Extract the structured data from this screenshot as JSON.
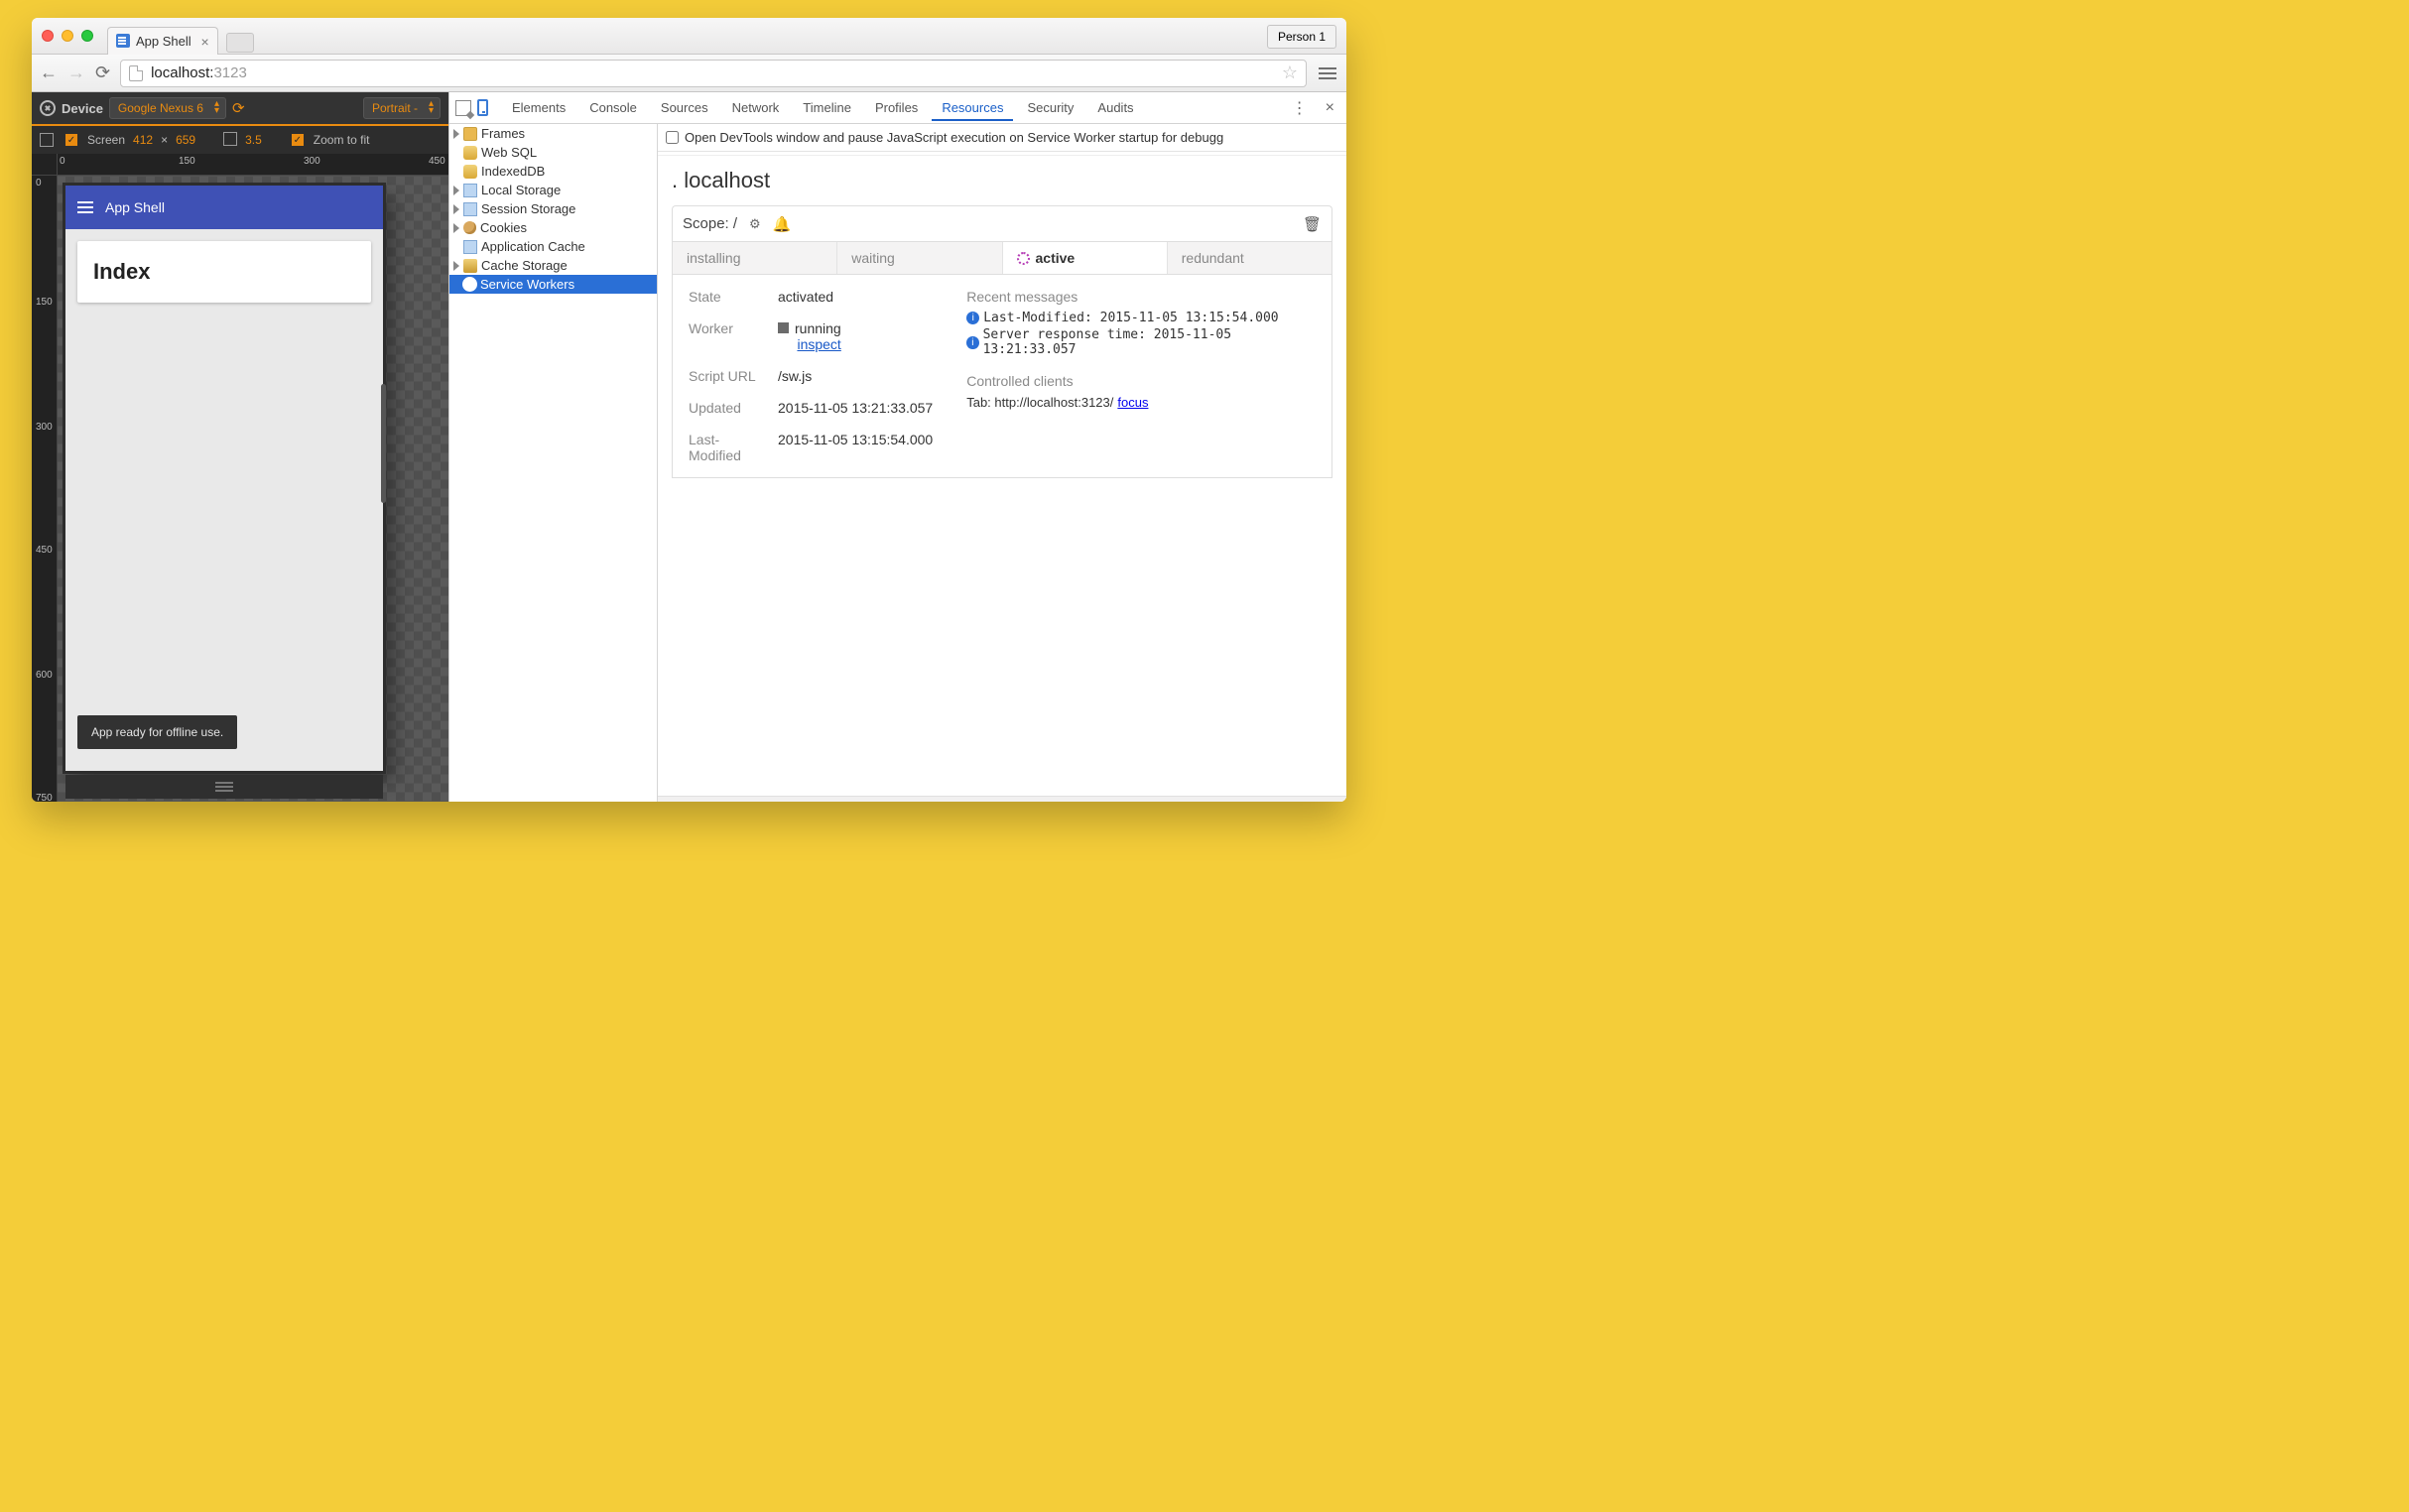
{
  "browser": {
    "tab_title": "App Shell",
    "person": "Person 1",
    "url_host": "localhost:",
    "url_port": "3123"
  },
  "device_mode": {
    "label": "Device",
    "device": "Google Nexus 6",
    "orientation": "Portrait -",
    "screen_label": "Screen",
    "width": "412",
    "height": "659",
    "dpr": "3.5",
    "zoom": "Zoom to fit",
    "ruler_h": [
      "0",
      "150",
      "300",
      "450"
    ],
    "ruler_v": [
      "0",
      "150",
      "300",
      "450",
      "600",
      "750"
    ]
  },
  "app": {
    "title": "App Shell",
    "card_title": "Index",
    "toast": "App ready for offline use."
  },
  "devtools": {
    "tabs": [
      "Elements",
      "Console",
      "Sources",
      "Network",
      "Timeline",
      "Profiles",
      "Resources",
      "Security",
      "Audits"
    ],
    "active_tab": "Resources",
    "pause_label": "Open DevTools window and pause JavaScript execution on Service Worker startup for debugg",
    "tree": [
      {
        "label": "Frames",
        "icon": "folder",
        "tri": true
      },
      {
        "label": "Web SQL",
        "icon": "db",
        "tri": false
      },
      {
        "label": "IndexedDB",
        "icon": "db",
        "tri": false
      },
      {
        "label": "Local Storage",
        "icon": "grid",
        "tri": true
      },
      {
        "label": "Session Storage",
        "icon": "grid",
        "tri": true
      },
      {
        "label": "Cookies",
        "icon": "cookie",
        "tri": true
      },
      {
        "label": "Application Cache",
        "icon": "grid",
        "tri": false
      },
      {
        "label": "Cache Storage",
        "icon": "stack",
        "tri": true
      },
      {
        "label": "Service Workers",
        "icon": "gear",
        "tri": false,
        "selected": true
      }
    ]
  },
  "sw": {
    "host": "localhost",
    "scope_label": "Scope: /",
    "tabs": [
      "installing",
      "waiting",
      "active",
      "redundant"
    ],
    "active_tab": "active",
    "state_label": "State",
    "state": "activated",
    "worker_label": "Worker",
    "worker_status": "running",
    "worker_inspect": "inspect",
    "script_label": "Script URL",
    "script": "/sw.js",
    "updated_label": "Updated",
    "updated": "2015-11-05 13:21:33.057",
    "lastmod_label": "Last-Modified",
    "lastmod": "2015-11-05 13:15:54.000",
    "recent_label": "Recent messages",
    "msg1": "Last-Modified: 2015-11-05 13:15:54.000",
    "msg2": "Server response time: 2015-11-05 13:21:33.057",
    "clients_label": "Controlled clients",
    "client_prefix": "Tab: http://localhost:3123/ ",
    "client_link": "focus"
  }
}
